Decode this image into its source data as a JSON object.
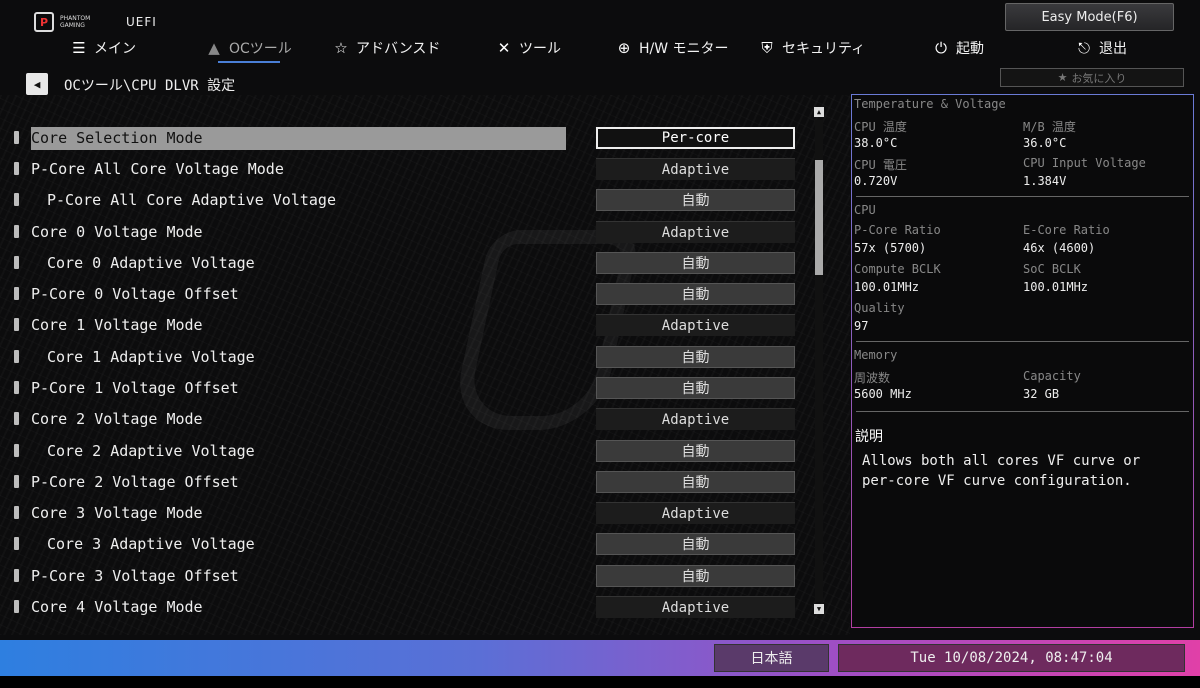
{
  "header": {
    "logo_badge": "P",
    "logo_text": "PHANTOM GAMING",
    "uefi_label": "UEFI",
    "easy_mode_label": "Easy Mode(F6)"
  },
  "nav": [
    {
      "label": "メイン",
      "icon": "list-icon"
    },
    {
      "label": "OCツール",
      "icon": "rocket-icon"
    },
    {
      "label": "アドバンスド",
      "icon": "star-icon"
    },
    {
      "label": "ツール",
      "icon": "tools-icon"
    },
    {
      "label": "H/W モニター",
      "icon": "crosshair-icon"
    },
    {
      "label": "セキュリティ",
      "icon": "shield-icon"
    },
    {
      "label": "起動",
      "icon": "power-icon"
    },
    {
      "label": "退出",
      "icon": "exit-icon"
    }
  ],
  "breadcrumb": "OCツール\\CPU DLVR 設定",
  "favorites_label": "お気に入り",
  "settings": [
    {
      "label": "Core Selection Mode",
      "value": "Per-core"
    },
    {
      "label": "P-Core All Core Voltage Mode",
      "value": "Adaptive"
    },
    {
      "label": "P-Core All Core Adaptive Voltage",
      "value": "自動"
    },
    {
      "label": "Core 0 Voltage Mode",
      "value": "Adaptive"
    },
    {
      "label": "Core 0 Adaptive Voltage",
      "value": "自動"
    },
    {
      "label": "P-Core 0 Voltage Offset",
      "value": "自動"
    },
    {
      "label": "Core 1 Voltage Mode",
      "value": "Adaptive"
    },
    {
      "label": "Core 1 Adaptive Voltage",
      "value": "自動"
    },
    {
      "label": "P-Core 1 Voltage Offset",
      "value": "自動"
    },
    {
      "label": "Core 2 Voltage Mode",
      "value": "Adaptive"
    },
    {
      "label": "Core 2 Adaptive Voltage",
      "value": "自動"
    },
    {
      "label": "P-Core 2 Voltage Offset",
      "value": "自動"
    },
    {
      "label": "Core 3 Voltage Mode",
      "value": "Adaptive"
    },
    {
      "label": "Core 3 Adaptive Voltage",
      "value": "自動"
    },
    {
      "label": "P-Core 3 Voltage Offset",
      "value": "自動"
    },
    {
      "label": "Core 4 Voltage Mode",
      "value": "Adaptive"
    }
  ],
  "panel": {
    "tv_title": "Temperature & Voltage",
    "cpu_temp_label": "CPU 温度",
    "cpu_temp": "38.0°C",
    "mb_temp_label": "M/B 温度",
    "mb_temp": "36.0°C",
    "cpu_volt_label": "CPU 電圧",
    "cpu_volt": "0.720V",
    "cpu_input_label": "CPU Input Voltage",
    "cpu_input": "1.384V",
    "cpu_title": "CPU",
    "pcore_label": "P-Core Ratio",
    "pcore": "57x (5700)",
    "ecore_label": "E-Core Ratio",
    "ecore": "46x (4600)",
    "compute_label": "Compute BCLK",
    "compute": "100.01MHz",
    "soc_label": "SoC BCLK",
    "soc": "100.01MHz",
    "quality_label": "Quality",
    "quality": "97",
    "mem_title": "Memory",
    "freq_label": "周波数",
    "freq": "5600 MHz",
    "cap_label": "Capacity",
    "cap": "32 GB",
    "desc_title": "説明",
    "desc_text": "Allows both all cores VF curve or per-core VF curve configuration."
  },
  "footer": {
    "language": "日本語",
    "datetime": "Tue 10/08/2024, 08:47:04"
  }
}
